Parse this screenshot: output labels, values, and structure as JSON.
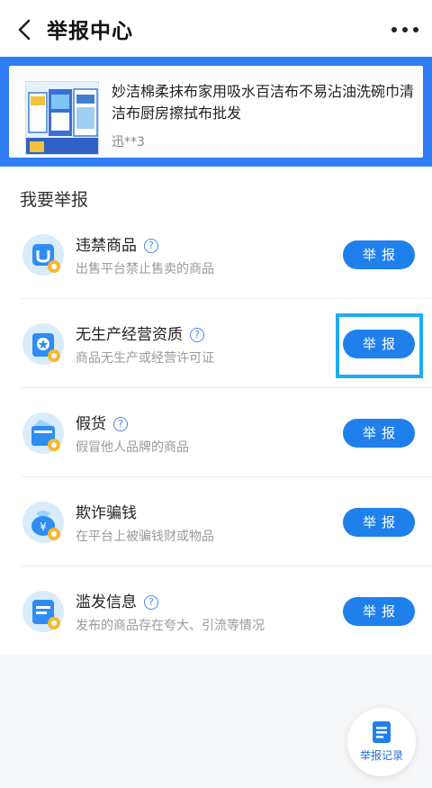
{
  "header": {
    "title": "举报中心",
    "back_icon": "chevron-left-icon",
    "more_icon": "more-dots-icon"
  },
  "product": {
    "title": "妙洁棉柔抹布家用吸水百洁布不易沾油洗碗巾清洁布厨房擦拭布批发",
    "seller": "迅**3",
    "highlight_color": "#2f7df5"
  },
  "section": {
    "title": "我要举报"
  },
  "categories": [
    {
      "name": "违禁商品",
      "desc": "出售平台禁止售卖的商品",
      "button": "举报",
      "icon": "prohibited-goods-icon"
    },
    {
      "name": "无生产经营资质",
      "desc": "商品无生产或经营许可证",
      "button": "举报",
      "icon": "no-license-icon"
    },
    {
      "name": "假货",
      "desc": "假冒他人品牌的商品",
      "button": "举报",
      "icon": "counterfeit-icon"
    },
    {
      "name": "欺诈骗钱",
      "desc": "在平台上被骗钱财或物品",
      "button": "举报",
      "icon": "fraud-money-icon"
    },
    {
      "name": "滥发信息",
      "desc": "发布的商品存在夸大、引流等情况",
      "button": "举报",
      "icon": "spam-info-icon"
    }
  ],
  "records": {
    "label": "举报记录",
    "icon": "document-icon"
  },
  "colors": {
    "accent": "#1f80ec",
    "highlight_box": "#20aaf0",
    "background": "#f5f6f8"
  }
}
